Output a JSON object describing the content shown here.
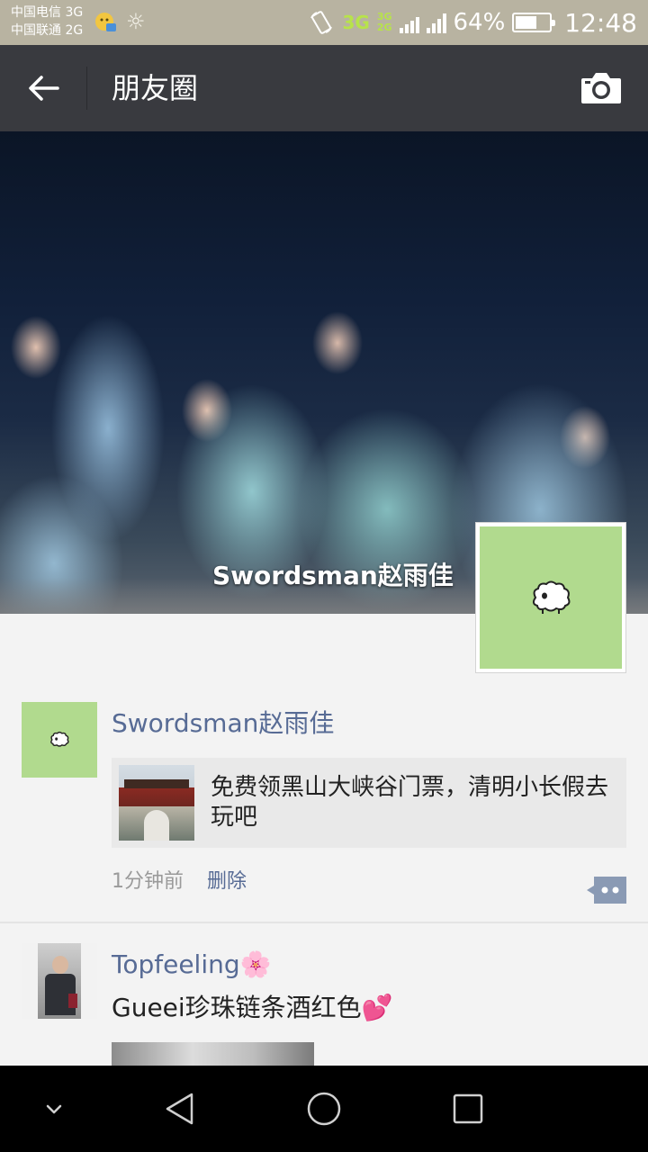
{
  "status_bar": {
    "carrier_1": "中国电信 3G",
    "carrier_2": "中国联通 2G",
    "network_badge": "3G",
    "dual_network_top": "3G",
    "dual_network_bottom": "2G",
    "battery_percent": "64%",
    "battery_level": 0.64,
    "time": "12:48"
  },
  "header": {
    "title": "朋友圈",
    "back_icon": "arrow-left-icon",
    "camera_icon": "camera-icon"
  },
  "cover": {
    "owner_name": "Swordsman赵雨佳"
  },
  "feed": [
    {
      "author": "Swordsman赵雨佳",
      "link_text": "免费领黑山大峡谷门票，清明小长假去玩吧",
      "time": "1分钟前",
      "delete_label": "删除"
    },
    {
      "author": "Topfeeling🌸",
      "text": "Gueei珍珠链条酒红色💕"
    }
  ],
  "colors": {
    "title_bar": "#393a3f",
    "link_blue": "#576b95",
    "avatar_green": "#b1da8e",
    "status_bar": "#b8b3a1"
  }
}
